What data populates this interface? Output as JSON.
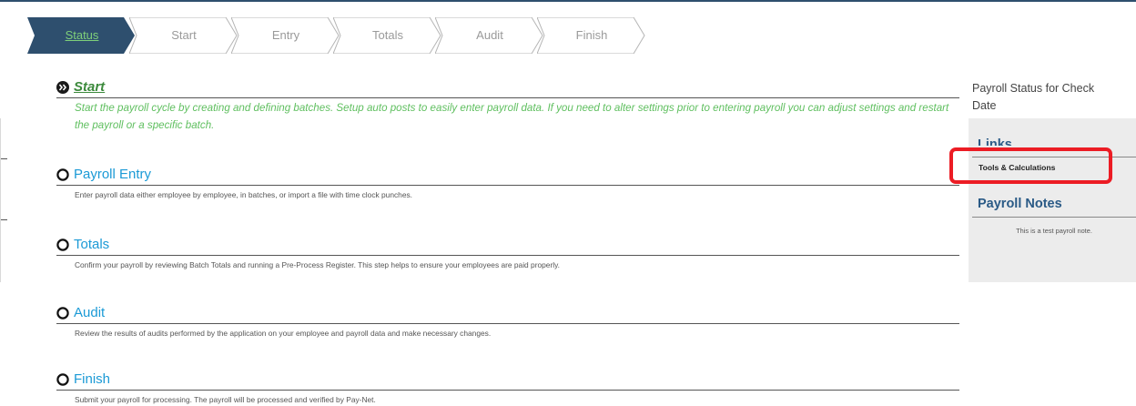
{
  "steps": [
    {
      "label": "Status",
      "active": true
    },
    {
      "label": "Start",
      "active": false
    },
    {
      "label": "Entry",
      "active": false
    },
    {
      "label": "Totals",
      "active": false
    },
    {
      "label": "Audit",
      "active": false
    },
    {
      "label": "Finish",
      "active": false
    }
  ],
  "stages": [
    {
      "title": "Start",
      "icon": "double-chevron-right-icon",
      "current": true,
      "description": "Start the payroll cycle by creating and defining batches. Setup auto posts to easily enter payroll data. If you need to alter settings prior to entering payroll you can adjust settings and restart the payroll or a specific batch."
    },
    {
      "title": "Payroll Entry",
      "icon": "circle-outline-icon",
      "current": false,
      "description": "Enter payroll data either employee by employee, in batches, or import a file with time clock punches."
    },
    {
      "title": "Totals",
      "icon": "circle-outline-icon",
      "current": false,
      "description": "Confirm your payroll by reviewing Batch Totals and running a Pre-Process Register. This step helps to ensure your employees are paid properly."
    },
    {
      "title": "Audit",
      "icon": "circle-outline-icon",
      "current": false,
      "description": "Review the results of audits performed by the application on your employee and payroll data and make necessary changes."
    },
    {
      "title": "Finish",
      "icon": "circle-outline-icon",
      "current": false,
      "description": "Submit your payroll for processing. The payroll will be processed and verified by Pay-Net."
    }
  ],
  "sidebar": {
    "status_title": "Payroll Status for Check Date",
    "links_heading": "Links",
    "links": [
      "Tools & Calculations"
    ],
    "notes_heading": "Payroll Notes",
    "notes_text": "This is a test payroll note."
  },
  "colors": {
    "active_step": "#2e4f6e",
    "active_text": "#7fd07a",
    "link_blue": "#1b9ad6",
    "highlight_box": "#ec1c24"
  }
}
